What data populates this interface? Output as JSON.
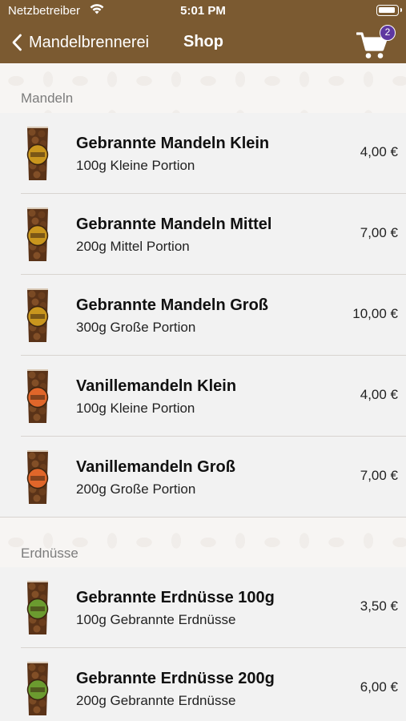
{
  "status_bar": {
    "carrier": "Netzbetreiber",
    "time": "5:01 PM"
  },
  "navbar": {
    "back_label": "Mandelbrennerei",
    "title": "Shop",
    "cart_count": "2"
  },
  "colors": {
    "header_bg": "#7b5a31",
    "badge_bg": "#5e37a0",
    "label_gold": "#c9961e",
    "label_orange": "#e0662a",
    "label_green": "#6b9b2f"
  },
  "sections": [
    {
      "title": "Mandeln",
      "items": [
        {
          "name": "Gebrannte Mandeln Klein",
          "description": "100g Kleine Portion",
          "price": "4,00 €",
          "label": "gold"
        },
        {
          "name": "Gebrannte Mandeln Mittel",
          "description": "200g Mittel Portion",
          "price": "7,00 €",
          "label": "gold"
        },
        {
          "name": "Gebrannte Mandeln Groß",
          "description": "300g Große Portion",
          "price": "10,00 €",
          "label": "gold"
        },
        {
          "name": "Vanillemandeln Klein",
          "description": "100g Kleine Portion",
          "price": "4,00 €",
          "label": "orange"
        },
        {
          "name": "Vanillemandeln Groß",
          "description": "200g Große Portion",
          "price": "7,00 €",
          "label": "orange"
        }
      ]
    },
    {
      "title": "Erdnüsse",
      "items": [
        {
          "name": "Gebrannte Erdnüsse 100g",
          "description": "100g Gebrannte Erdnüsse",
          "price": "3,50 €",
          "label": "green"
        },
        {
          "name": "Gebrannte Erdnüsse 200g",
          "description": "200g Gebrannte Erdnüsse",
          "price": "6,00 €",
          "label": "green"
        }
      ]
    }
  ]
}
